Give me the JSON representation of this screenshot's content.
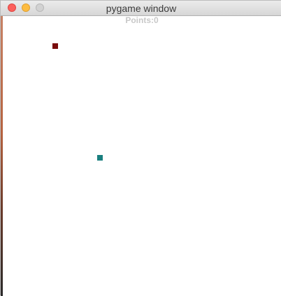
{
  "window": {
    "title": "pygame window"
  },
  "game": {
    "score_text": "Points:0",
    "score_color": "#c8c8c8",
    "food_color": "#7a0c0c",
    "snake_color": "#1a7f7f"
  }
}
